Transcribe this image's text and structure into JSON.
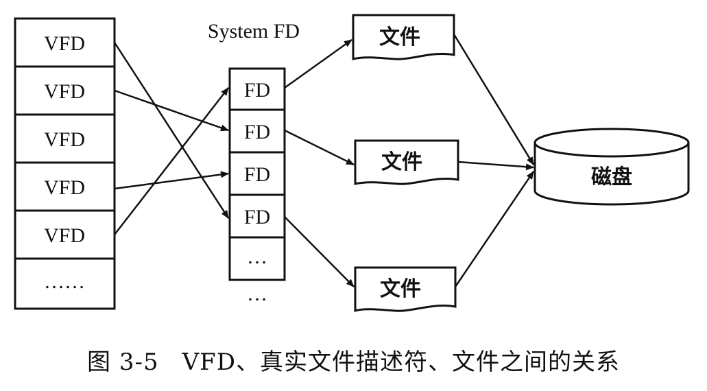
{
  "vfd_column": {
    "cells": [
      "VFD",
      "VFD",
      "VFD",
      "VFD",
      "VFD",
      "……"
    ]
  },
  "fd_column": {
    "header": "System FD",
    "cells": [
      "FD",
      "FD",
      "FD",
      "FD",
      "…"
    ],
    "trailing": "…"
  },
  "files": [
    "文件",
    "文件",
    "文件"
  ],
  "disk": "磁盘",
  "caption": {
    "number": "图 3-5",
    "text": "VFD、真实文件描述符、文件之间的关系"
  }
}
